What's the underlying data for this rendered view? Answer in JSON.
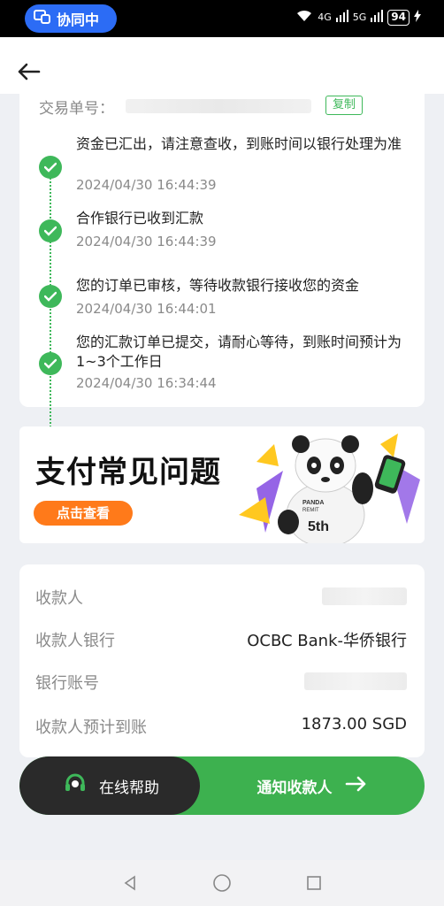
{
  "status_bar": {
    "collab_label": "协同中",
    "network_1": "4G",
    "network_2": "5G",
    "battery": "94"
  },
  "order": {
    "label": "交易单号：",
    "copy_label": "复制"
  },
  "timeline": [
    {
      "text": "资金已汇出，请注意查收，到账时间以银行处理为准",
      "time": "2024/04/30 16:44:39"
    },
    {
      "text": "合作银行已收到汇款",
      "time": "2024/04/30 16:44:39"
    },
    {
      "text": "您的订单已审核，等待收款银行接收您的资金",
      "time": "2024/04/30 16:44:01"
    },
    {
      "text": "您的汇款订单已提交，请耐心等待，到账时间预计为1~3个工作日",
      "time": "2024/04/30 16:34:44"
    }
  ],
  "banner": {
    "title": "支付常见问题",
    "button": "点击查看",
    "mascot_text_1": "PANDA",
    "mascot_text_2": "REMIT",
    "mascot_text_3": "5th"
  },
  "info": {
    "payee_label": "收款人",
    "bank_label": "收款人银行",
    "bank_value": "OCBC Bank-华侨银行",
    "account_label": "银行账号",
    "amount_label": "收款人预计到账",
    "amount_value": "1873.00 SGD"
  },
  "actions": {
    "help_label": "在线帮助",
    "notify_label": "通知收款人"
  },
  "colors": {
    "accent_green": "#3eb85a",
    "orange": "#ff7a1a",
    "blue": "#2c6cf5"
  }
}
